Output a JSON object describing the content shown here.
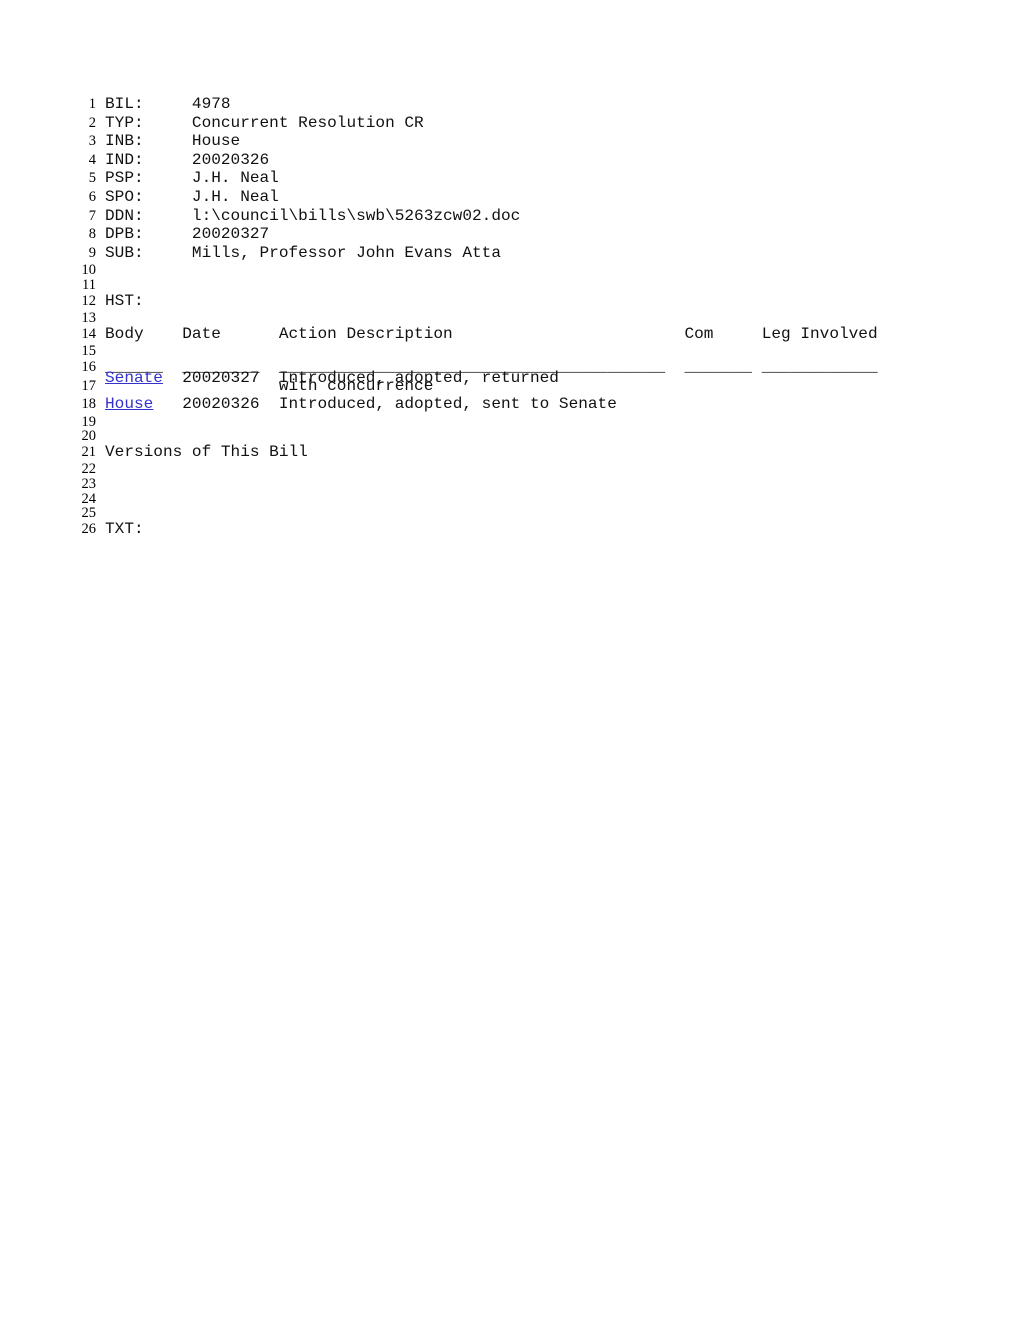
{
  "document": {
    "background_color": "#ffffff",
    "text_color": "#111111",
    "link_color": "#3333cc",
    "fields": {
      "bil_label": "BIL:",
      "bil_value": "4978",
      "typ_label": "TYP:",
      "typ_value": "Concurrent Resolution CR",
      "inb_label": "INB:",
      "inb_value": "House",
      "ind_label": "IND:",
      "ind_value": "20020326",
      "psp_label": "PSP:",
      "psp_value": "J.H. Neal",
      "spo_label": "SPO:",
      "spo_value": "J.H. Neal",
      "ddn_label": "DDN:",
      "ddn_value": "l:\\council\\bills\\swb\\5263zcw02.doc",
      "dpb_label": "DPB:",
      "dpb_value": "20020327",
      "sub_label": "SUB:",
      "sub_value": "Mills, Professor John Evans Atta",
      "hst_label": "HST:",
      "txt_label": "TXT:"
    },
    "history_table": {
      "headers": [
        "Body",
        "Date",
        "Action Description",
        "Com",
        "Leg Involved"
      ],
      "separator": [
        "______",
        "________",
        "________________________________________",
        "_______",
        "____________"
      ],
      "rows": [
        {
          "body": "Senate",
          "body_is_link": true,
          "date": "20020327",
          "action": "Introduced, adopted, returned",
          "action_continued": "with concurrence",
          "com": "",
          "leg_involved": ""
        },
        {
          "body": "House",
          "body_is_link": true,
          "date": "20020326",
          "action": "Introduced, adopted, sent to Senate",
          "action_continued": "",
          "com": "",
          "leg_involved": ""
        }
      ]
    },
    "versions_heading": "Versions of This Bill",
    "lines": [
      {
        "n": "1",
        "text": "BIL:     4978",
        "blank": false
      },
      {
        "n": "2",
        "text": "TYP:     Concurrent Resolution CR",
        "blank": false
      },
      {
        "n": "3",
        "text": "INB:     House",
        "blank": false
      },
      {
        "n": "4",
        "text": "IND:     20020326",
        "blank": false
      },
      {
        "n": "5",
        "text": "PSP:     J.H. Neal",
        "blank": false
      },
      {
        "n": "6",
        "text": "SPO:     J.H. Neal",
        "blank": false
      },
      {
        "n": "7",
        "text": "DDN:     l:\\council\\bills\\swb\\5263zcw02.doc",
        "blank": false
      },
      {
        "n": "8",
        "text": "DPB:     20020327",
        "blank": false
      },
      {
        "n": "9",
        "text": "SUB:     Mills, Professor John Evans Atta",
        "blank": false
      },
      {
        "n": "10",
        "text": "",
        "blank": true
      },
      {
        "n": "11",
        "text": "",
        "blank": true
      },
      {
        "n": "12",
        "text": "HST:",
        "blank": false
      },
      {
        "n": "13",
        "text": "",
        "blank": true
      },
      {
        "n": "14",
        "text": "Body    Date      Action Description                        Com     Leg Involved",
        "blank": false
      },
      {
        "n": "15",
        "text": "",
        "blank": true
      },
      {
        "n": "16",
        "text": "______  ________  ________________________________________  _______ ____________",
        "blank": false
      },
      {
        "n": "17",
        "text": "",
        "blank": true
      },
      {
        "n": "18",
        "text": "",
        "blank": true
      },
      {
        "n": "19",
        "text": "",
        "blank": true
      },
      {
        "n": "20",
        "text": "",
        "blank": true
      },
      {
        "n": "21",
        "text": "Versions of This Bill",
        "blank": false
      },
      {
        "n": "22",
        "text": "",
        "blank": true
      },
      {
        "n": "23",
        "text": "",
        "blank": true
      },
      {
        "n": "24",
        "text": "",
        "blank": true
      },
      {
        "n": "25",
        "text": "",
        "blank": true
      },
      {
        "n": "26",
        "text": "TXT:",
        "blank": false
      }
    ],
    "render_lines": [
      {
        "n": "1",
        "blank": false,
        "segments": [
          {
            "t": "BIL:     4978"
          }
        ]
      },
      {
        "n": "2",
        "blank": false,
        "segments": [
          {
            "t": "TYP:     Concurrent Resolution CR"
          }
        ]
      },
      {
        "n": "3",
        "blank": false,
        "segments": [
          {
            "t": "INB:     House"
          }
        ]
      },
      {
        "n": "4",
        "blank": false,
        "segments": [
          {
            "t": "IND:     20020326"
          }
        ]
      },
      {
        "n": "5",
        "blank": false,
        "segments": [
          {
            "t": "PSP:     J.H. Neal"
          }
        ]
      },
      {
        "n": "6",
        "blank": false,
        "segments": [
          {
            "t": "SPO:     J.H. Neal"
          }
        ]
      },
      {
        "n": "7",
        "blank": false,
        "segments": [
          {
            "t": "DDN:     l:\\council\\bills\\swb\\5263zcw02.doc"
          }
        ]
      },
      {
        "n": "8",
        "blank": false,
        "segments": [
          {
            "t": "DPB:     20020327"
          }
        ]
      },
      {
        "n": "9",
        "blank": false,
        "segments": [
          {
            "t": "SUB:     Mills, Professor John Evans Atta"
          }
        ]
      },
      {
        "n": "10",
        "blank": true,
        "segments": [
          {
            "t": ""
          }
        ]
      },
      {
        "n": "11",
        "blank": true,
        "segments": [
          {
            "t": ""
          }
        ]
      },
      {
        "n": "12",
        "blank": false,
        "segments": [
          {
            "t": "HST:"
          }
        ]
      },
      {
        "n": "13",
        "blank": true,
        "segments": [
          {
            "t": ""
          }
        ]
      },
      {
        "n": "14",
        "blank": false,
        "segments": [
          {
            "t": "Body    Date      Action Description                        Com     Leg Involved"
          }
        ]
      },
      {
        "n": "15",
        "blank": true,
        "segments": [
          {
            "t": ""
          }
        ]
      },
      {
        "n": "16",
        "blank": false,
        "segments": [
          {
            "t": ""
          }
        ]
      },
      {
        "n": "17",
        "blank": false,
        "segments": [
          {
            "t": ""
          }
        ]
      },
      {
        "n": "18",
        "blank": false,
        "segments": [
          {
            "t": ""
          }
        ]
      },
      {
        "n": "19",
        "blank": true,
        "segments": [
          {
            "t": ""
          }
        ]
      },
      {
        "n": "20",
        "blank": true,
        "segments": [
          {
            "t": ""
          }
        ]
      },
      {
        "n": "21",
        "blank": false,
        "segments": [
          {
            "t": "Versions of This Bill"
          }
        ]
      },
      {
        "n": "22",
        "blank": true,
        "segments": [
          {
            "t": ""
          }
        ]
      },
      {
        "n": "23",
        "blank": true,
        "segments": [
          {
            "t": ""
          }
        ]
      },
      {
        "n": "24",
        "blank": true,
        "segments": [
          {
            "t": ""
          }
        ]
      },
      {
        "n": "25",
        "blank": true,
        "segments": [
          {
            "t": ""
          }
        ]
      },
      {
        "n": "26",
        "blank": false,
        "segments": [
          {
            "t": "TXT:"
          }
        ]
      }
    ],
    "overlay_lines": {
      "sep_row": "______  ________  ________________________________________  _______ ____________",
      "senate_prefix": "",
      "senate_link": "Senate",
      "senate_rest": "  20020327  Introduced, adopted, returned",
      "cont_row": "                  with concurrence",
      "house_link": "House",
      "house_rest": "   20020326  Introduced, adopted, sent to Senate"
    }
  }
}
